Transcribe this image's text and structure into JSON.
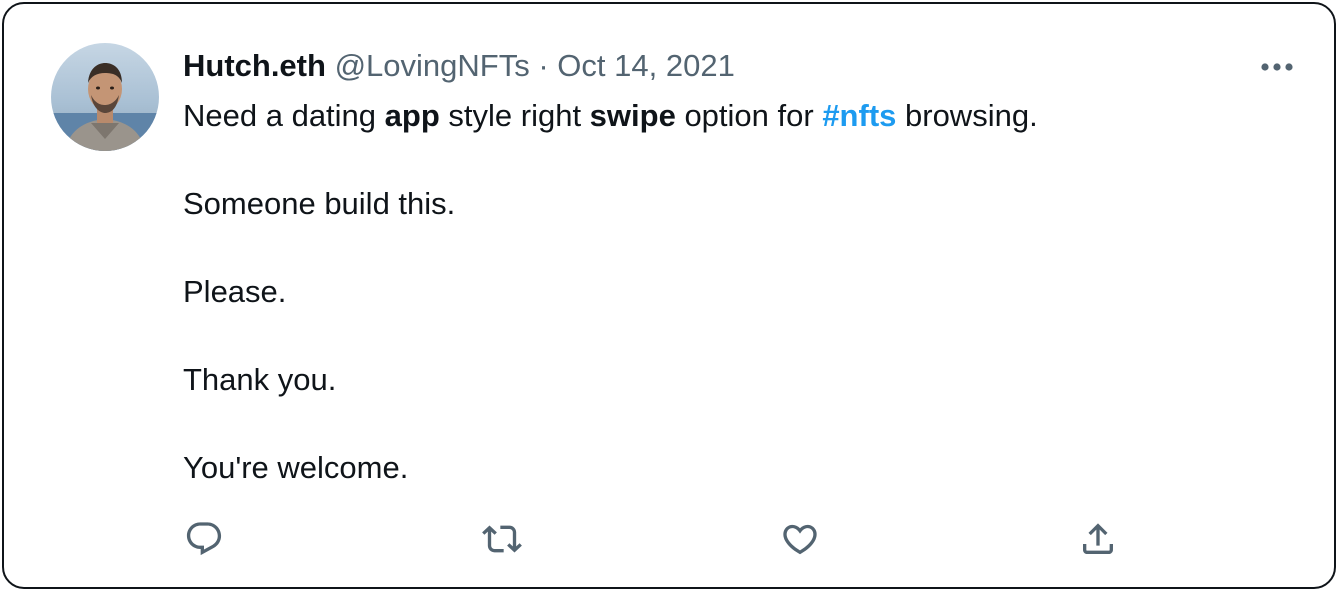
{
  "tweet": {
    "display_name": "Hutch.eth",
    "handle": "@LovingNFTs",
    "separator": "·",
    "date": "Oct 14, 2021",
    "lines": [
      {
        "pre": "Need a dating ",
        "bold1": "app",
        "mid1": " style right ",
        "bold2": "swipe",
        "mid2": " option for ",
        "hashtag": "#nfts",
        "post": " browsing."
      },
      {
        "text": "Someone build this."
      },
      {
        "text": "Please."
      },
      {
        "text": "Thank you."
      },
      {
        "text": "You're welcome."
      }
    ]
  },
  "icons": {
    "more": "more-horizontal-icon",
    "reply": "reply-icon",
    "retweet": "retweet-icon",
    "like": "heart-icon",
    "share": "share-icon"
  },
  "colors": {
    "text": "#0f1419",
    "secondary": "#536471",
    "hashtag": "#1d9bf0",
    "border": "#0f1419"
  }
}
